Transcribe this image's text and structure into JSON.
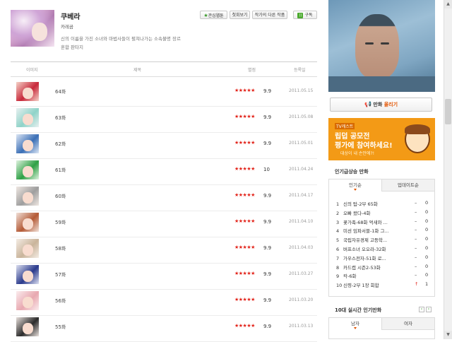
{
  "comic": {
    "title": "쿠베라",
    "author": "카레곰",
    "description": "신의 이름을 가진 소녀와 마법사들이 펼쳐나가는 소속불명 장르 혼합 판타지"
  },
  "buttons": {
    "favorite": "관심웹툰",
    "first_episode": "첫회보기",
    "other_works": "작가의 다른 작품",
    "subscribe": "구독"
  },
  "table_headers": {
    "image": "이미지",
    "title": "제목",
    "rating": "별점",
    "date": "등록일"
  },
  "episodes": [
    {
      "title": "64화",
      "rating": "9.9",
      "date": "2011.05.15"
    },
    {
      "title": "63화",
      "rating": "9.9",
      "date": "2011.05.08"
    },
    {
      "title": "62화",
      "rating": "9.9",
      "date": "2011.05.01"
    },
    {
      "title": "61화",
      "rating": "10",
      "date": "2011.04.24"
    },
    {
      "title": "60화",
      "rating": "9.9",
      "date": "2011.04.17"
    },
    {
      "title": "59화",
      "rating": "9.9",
      "date": "2011.04.10"
    },
    {
      "title": "58화",
      "rating": "9.9",
      "date": "2011.04.03"
    },
    {
      "title": "57화",
      "rating": "9.9",
      "date": "2011.03.27"
    },
    {
      "title": "56화",
      "rating": "9.9",
      "date": "2011.03.20"
    },
    {
      "title": "55화",
      "rating": "9.9",
      "date": "2011.03.13"
    }
  ],
  "stars_text": "★★★★★",
  "upload": {
    "prefix": "만화",
    "highlight": "올리기"
  },
  "banner": {
    "tag": "TV캐스트",
    "line1": "립덥 공모전",
    "line2": "평가에 참여하세요!",
    "line3": "대상이 내 손안에?!"
  },
  "rising": {
    "title": "인기급상승 만화",
    "tabs": [
      "인기순",
      "업데이트순"
    ],
    "items": [
      {
        "rank": "1",
        "title": "신의 탑-2부 65화",
        "trend": "–",
        "delta": "0"
      },
      {
        "rank": "2",
        "title": "오빠 왔다-4화",
        "trend": "–",
        "delta": "0"
      },
      {
        "rank": "3",
        "title": "꽃가족-68화 억새와 ...",
        "trend": "–",
        "delta": "0"
      },
      {
        "rank": "4",
        "title": "미션 임파서블-1화 그...",
        "trend": "–",
        "delta": "0"
      },
      {
        "rank": "5",
        "title": "국립자유경제 고등학...",
        "trend": "–",
        "delta": "0"
      },
      {
        "rank": "6",
        "title": "버프소녀 오오라-32화",
        "trend": "–",
        "delta": "0"
      },
      {
        "rank": "7",
        "title": "가우스전자-51화 로...",
        "trend": "–",
        "delta": "0"
      },
      {
        "rank": "8",
        "title": "카드캡 시즌2-53화",
        "trend": "–",
        "delta": "0"
      },
      {
        "rank": "9",
        "title": "칵-6화",
        "trend": "–",
        "delta": "0"
      },
      {
        "rank": "10",
        "title": "신령-2부 1장 회합",
        "trend": "↑",
        "delta": "1"
      }
    ]
  },
  "realtime": {
    "title": "10대 실시간 인기만화",
    "tabs": [
      "남자",
      "여자"
    ],
    "prev": "‹",
    "next": "›"
  }
}
